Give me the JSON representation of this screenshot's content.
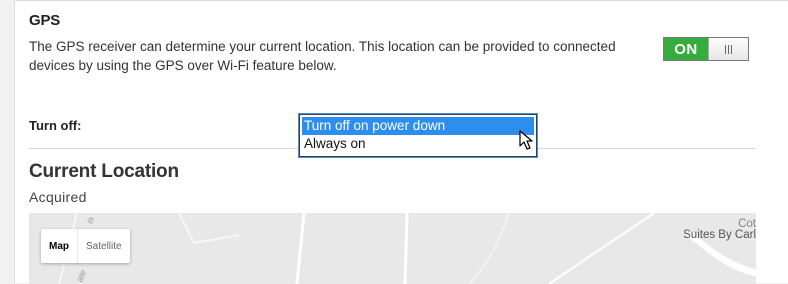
{
  "gps": {
    "title": "GPS",
    "description": "The GPS receiver can determine your current location. This location can be provided to connected devices by using the GPS over Wi-Fi feature below.",
    "toggle_label": "ON",
    "toggle_on": true,
    "toggle_color": "#35ad3c"
  },
  "turn_off": {
    "label": "Turn off:",
    "options": [
      "Turn off on power down",
      "Always on"
    ],
    "selected": "Turn off on power down",
    "highlight_color": "#2d8ef0"
  },
  "location": {
    "title": "Current Location",
    "status": "Acquired"
  },
  "map": {
    "type_buttons": [
      "Map",
      "Satellite"
    ],
    "poi_top": "Cot",
    "poi_label": "Suites By Carl",
    "road_label_1": "is",
    "road_label_2": "ate"
  }
}
